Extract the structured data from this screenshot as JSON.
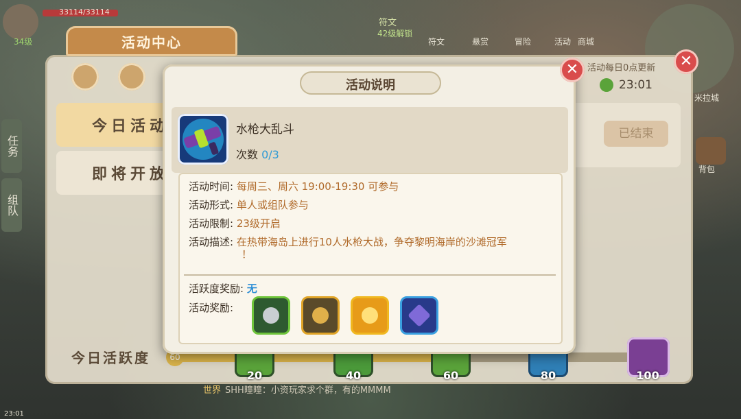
{
  "hud": {
    "hp": "33114/33114",
    "level": "34级",
    "rune_unlock": "42级解锁",
    "rune_label": "符文",
    "top_buttons": [
      "符文",
      "悬赏",
      "冒险",
      "活动",
      "商城"
    ],
    "backpack": "背包",
    "city": "米拉城",
    "time": "23:01"
  },
  "activity_center": {
    "title": "活动中心",
    "tabs": [
      "今日活动",
      "即将开放"
    ],
    "side_tabs": [
      "任务",
      "组队"
    ],
    "reset_text": "活动每日0点更新",
    "reset_time": "23:01",
    "ended_label": "已结束",
    "progress_label": "今日活跃度",
    "progress_value": 60,
    "milestones": [
      "20",
      "40",
      "60",
      "80",
      "100"
    ]
  },
  "chat": {
    "channel": "世界",
    "message": "SHH瞳瞳：小资玩家求个群，有的MMMM"
  },
  "dialog": {
    "title": "活动说明",
    "activity_name": "水枪大乱斗",
    "count_label": "次数",
    "count_value": "0/3",
    "rows": [
      {
        "label": "活动时间:",
        "value": "每周三、周六 19:00-19:30 可参与"
      },
      {
        "label": "活动形式:",
        "value": "单人或组队参与"
      },
      {
        "label": "活动限制:",
        "value": "23级开启"
      },
      {
        "label": "活动描述:",
        "value": "在热带海岛上进行10人水枪大战，争夺黎明海岸的沙滩冠军"
      },
      {
        "label": "",
        "value": "！"
      }
    ],
    "activity_reward_label": "活跃度奖励:",
    "activity_reward_value": "无",
    "reward_label": "活动奖励:",
    "rewards": [
      {
        "name": "silver-coins",
        "border": "#6ec43a",
        "fill": "#2e5a30"
      },
      {
        "name": "frame-badge",
        "border": "#e0a427",
        "fill": "#5a4a2a"
      },
      {
        "name": "sun-pet",
        "border": "#f0b820",
        "fill": "#e79b19"
      },
      {
        "name": "purple-crystal",
        "border": "#3aa0e0",
        "fill": "#283a8a"
      }
    ]
  },
  "colors": {
    "accent_orange": "#b06a2a",
    "accent_blue": "#2e9ad6",
    "close_red": "#d94c4c"
  }
}
